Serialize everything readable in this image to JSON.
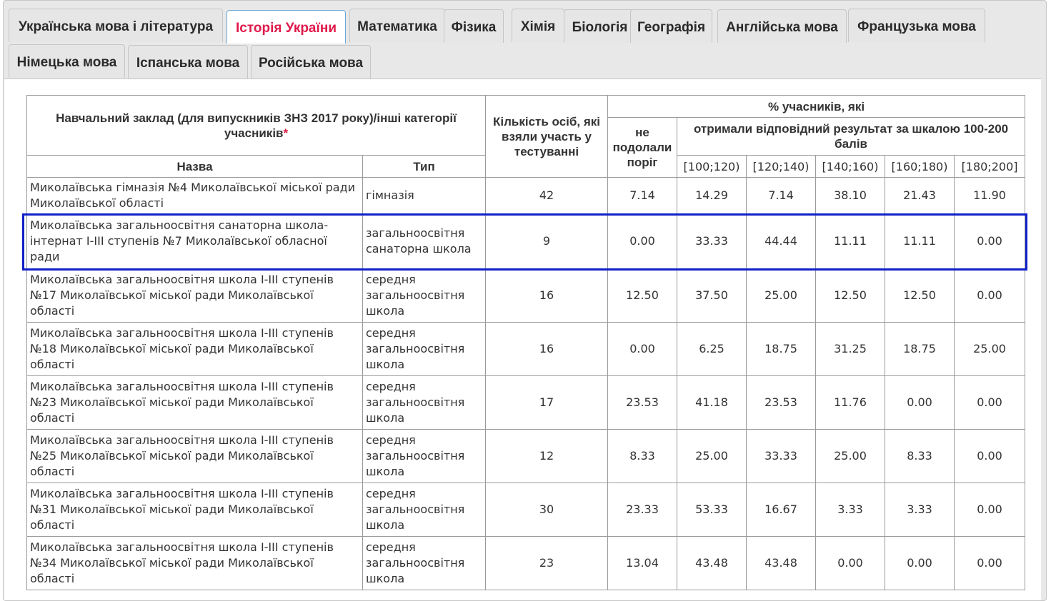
{
  "tabs": [
    {
      "label": "Українська мова і література",
      "active": false
    },
    {
      "label": "Історія України",
      "active": true
    },
    {
      "label": "Математика",
      "active": false
    },
    {
      "label": "Фізика",
      "active": false
    },
    {
      "label": "Хімія",
      "active": false
    },
    {
      "label": "Біологія",
      "active": false
    },
    {
      "label": "Географія",
      "active": false
    },
    {
      "label": "Англійська мова",
      "active": false
    },
    {
      "label": "Французька мова",
      "active": false
    },
    {
      "label": "Німецька мова",
      "active": false
    },
    {
      "label": "Іспанська мова",
      "active": false
    },
    {
      "label": "Російська мова",
      "active": false
    }
  ],
  "table": {
    "header": {
      "institution": "Навчальний заклад (для випускників ЗНЗ 2017 року)/інші категорії учасників",
      "required_mark": "*",
      "count": "Кількість осіб, які взяли участь у тестуванні",
      "percent": "% учасників, які",
      "not_passed": "не подолали поріг",
      "received": "отримали відповідний результат за шкалою 100-200 балів",
      "name": "Назва",
      "type": "Тип",
      "ranges": [
        "[100;120)",
        "[120;140)",
        "[140;160)",
        "[160;180)",
        "[180;200]"
      ]
    },
    "rows": [
      {
        "name": "Миколаївська гімназія №4 Миколаївської міської ради Миколаївської області",
        "type": "гімназія",
        "count": "42",
        "not_passed": "7.14",
        "r1": "14.29",
        "r2": "7.14",
        "r3": "38.10",
        "r4": "21.43",
        "r5": "11.90"
      },
      {
        "name": "Миколаївська загальноосвітня санаторна школа-інтернат І-ІІІ ступенів №7 Миколаївської обласної ради",
        "type": "загальноосвітня санаторна школа",
        "count": "9",
        "not_passed": "0.00",
        "r1": "33.33",
        "r2": "44.44",
        "r3": "11.11",
        "r4": "11.11",
        "r5": "0.00"
      },
      {
        "name": "Миколаївська загальноосвітня школа І-ІІІ ступенів №17 Миколаївської міської ради Миколаївської області",
        "type": "середня загальноосвітня школа",
        "count": "16",
        "not_passed": "12.50",
        "r1": "37.50",
        "r2": "25.00",
        "r3": "12.50",
        "r4": "12.50",
        "r5": "0.00"
      },
      {
        "name": "Миколаївська загальноосвітня школа І-ІІІ ступенів №18 Миколаївської міської ради Миколаївської області",
        "type": "середня загальноосвітня школа",
        "count": "16",
        "not_passed": "0.00",
        "r1": "6.25",
        "r2": "18.75",
        "r3": "31.25",
        "r4": "18.75",
        "r5": "25.00"
      },
      {
        "name": "Миколаївська загальноосвітня школа І-ІІІ ступенів №23 Миколаївської міської ради Миколаївської області",
        "type": "середня загальноосвітня школа",
        "count": "17",
        "not_passed": "23.53",
        "r1": "41.18",
        "r2": "23.53",
        "r3": "11.76",
        "r4": "0.00",
        "r5": "0.00"
      },
      {
        "name": "Миколаївська загальноосвітня школа І-ІІІ ступенів №25 Миколаївської міської ради Миколаївської області",
        "type": "середня загальноосвітня школа",
        "count": "12",
        "not_passed": "8.33",
        "r1": "25.00",
        "r2": "33.33",
        "r3": "25.00",
        "r4": "8.33",
        "r5": "0.00"
      },
      {
        "name": "Миколаївська загальноосвітня школа І-ІІІ ступенів №31 Миколаївської міської ради Миколаївської області",
        "type": "середня загальноосвітня школа",
        "count": "30",
        "not_passed": "23.33",
        "r1": "53.33",
        "r2": "16.67",
        "r3": "3.33",
        "r4": "3.33",
        "r5": "0.00"
      },
      {
        "name": "Миколаївська загальноосвітня школа І-ІІІ ступенів №34 Миколаївської міської ради Миколаївської області",
        "type": "середня загальноосвітня школа",
        "count": "23",
        "not_passed": "13.04",
        "r1": "43.48",
        "r2": "43.48",
        "r3": "0.00",
        "r4": "0.00",
        "r5": "0.00"
      }
    ]
  },
  "colors": {
    "active_tab_text": "#e0194a",
    "highlight_border": "#1020c8"
  }
}
